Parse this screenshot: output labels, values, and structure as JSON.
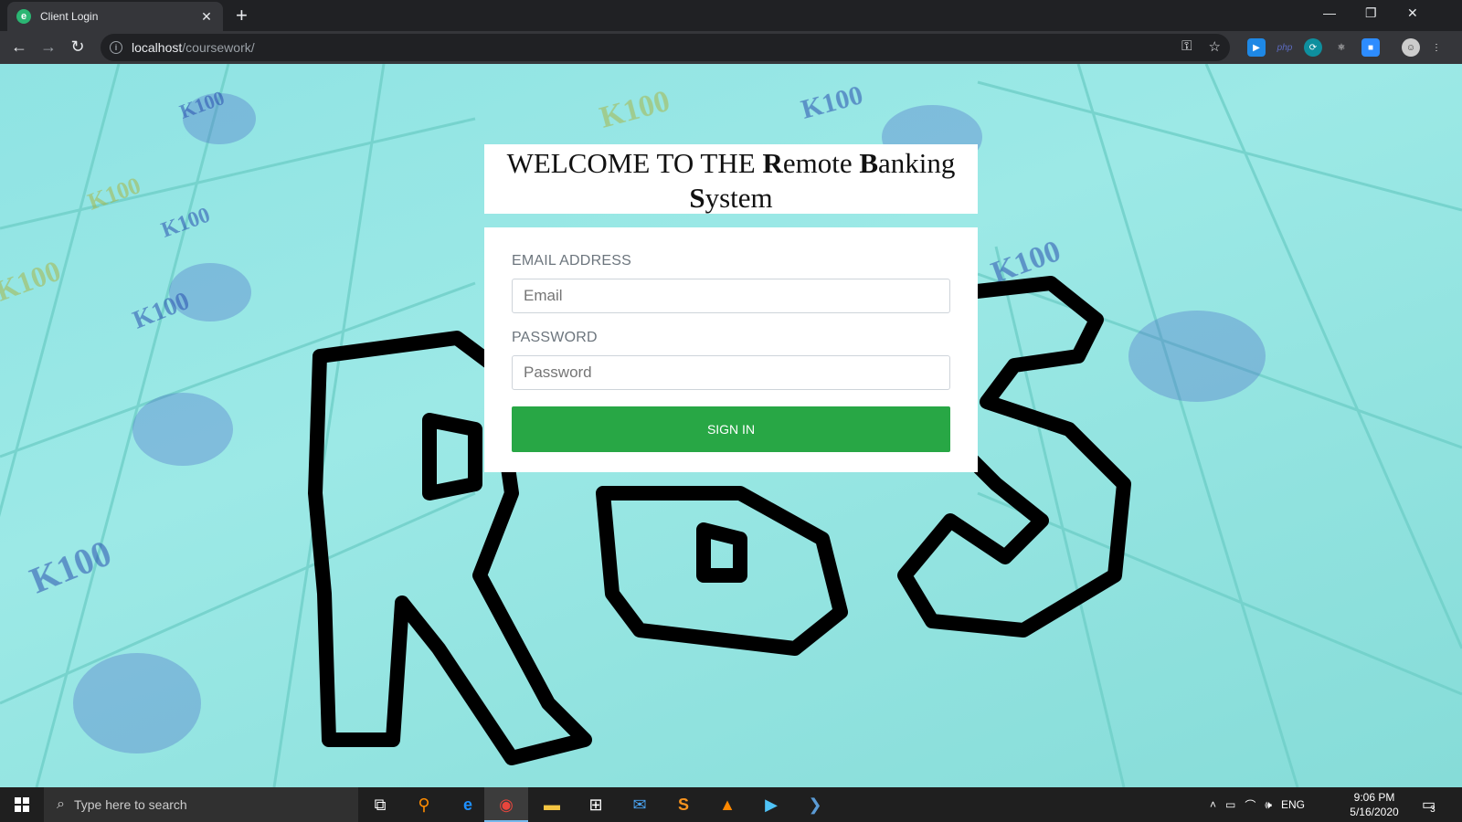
{
  "browser": {
    "tab_title": "Client Login",
    "tab_favicon_letter": "e",
    "url_host": "localhost",
    "url_path": "/coursework/"
  },
  "page": {
    "welcome_prefix": "WELCOME TO THE ",
    "welcome_R": "R",
    "welcome_emote": "emote ",
    "welcome_B": "B",
    "welcome_anking": "anking",
    "welcome_S": "S",
    "welcome_ystem": "ystem",
    "email_label": "EMAIL ADDRESS",
    "email_placeholder": "Email",
    "password_label": "PASSWORD",
    "password_placeholder": "Password",
    "signin_label": "SIGN IN",
    "logo_text": "RBS"
  },
  "taskbar": {
    "search_placeholder": "Type here to search",
    "language": "ENG",
    "time": "9:06 PM",
    "date": "5/16/2020",
    "notification_count": "3"
  },
  "colors": {
    "accent_green": "#28a745",
    "page_background": "#9ce9e6",
    "chrome_dark": "#202124"
  }
}
